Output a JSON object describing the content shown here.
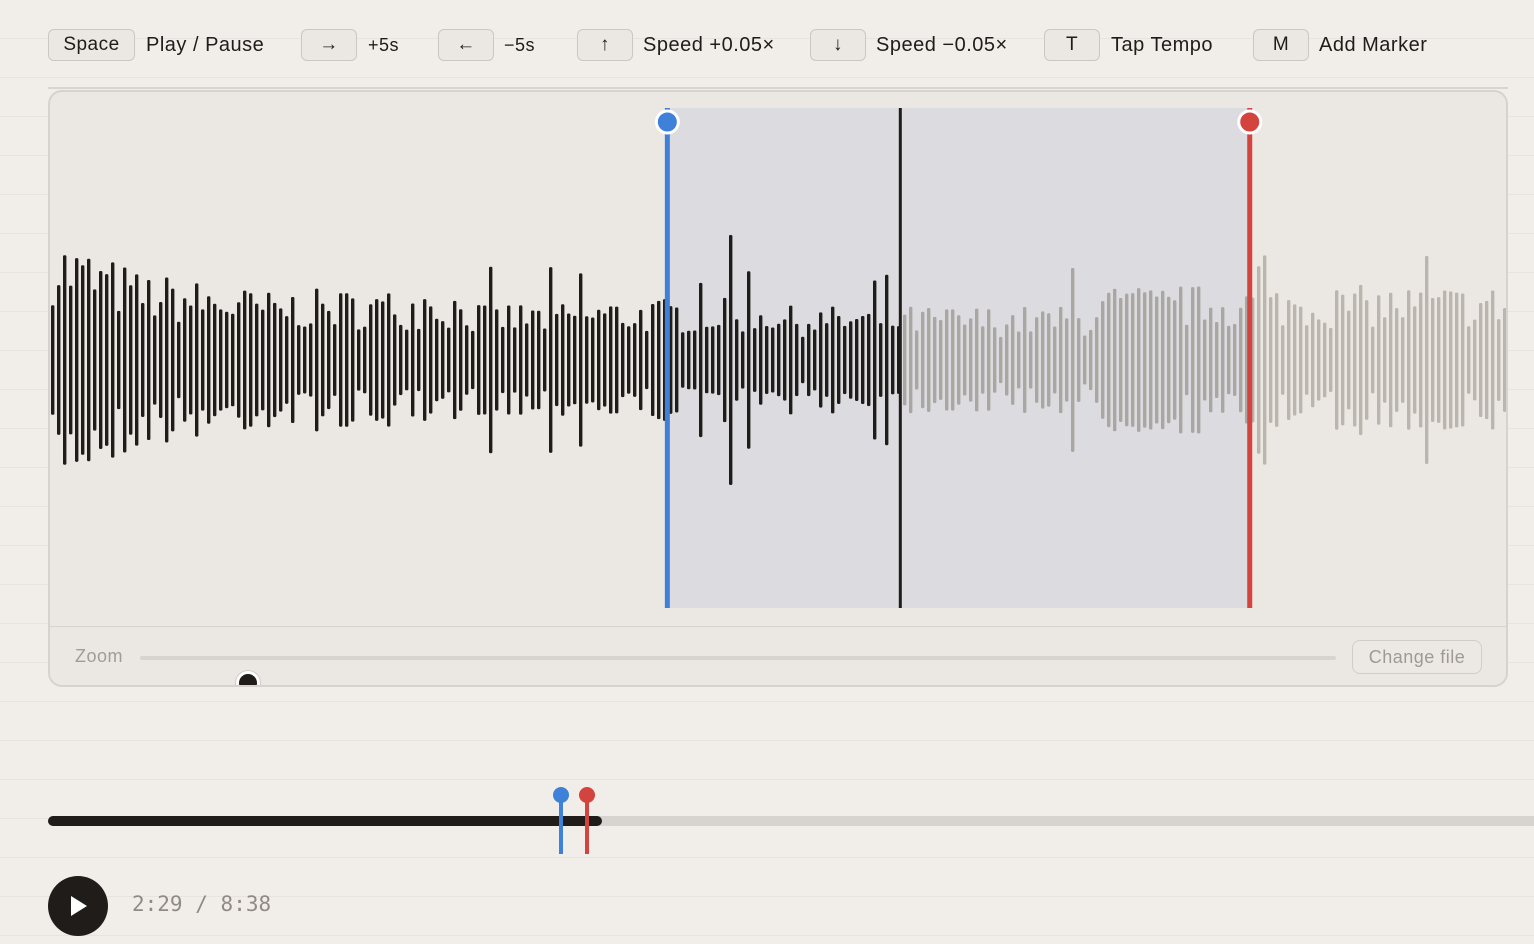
{
  "shortcuts": [
    {
      "key": "Space",
      "label": "Play / Pause"
    },
    {
      "key": "→",
      "label": "+5s"
    },
    {
      "key": "←",
      "label": "−5s"
    },
    {
      "key": "↑",
      "label": "Speed +0.05×"
    },
    {
      "key": "↓",
      "label": "Speed −0.05×"
    },
    {
      "key": "T",
      "label": "Tap Tempo"
    },
    {
      "key": "M",
      "label": "Add Marker"
    }
  ],
  "waveform": {
    "loop_start_seconds": 139,
    "playhead_seconds": 149,
    "loop_end_seconds": 164,
    "colors": {
      "played": "#1f1c19",
      "unplayed": "#aaa7a3",
      "outside_loop": "#bab5ae",
      "loop_region": "#dcdce0",
      "start_marker": "#3f80d8",
      "end_marker": "#d2443d",
      "playhead": "#1f1c19"
    }
  },
  "zoom": {
    "label": "Zoom",
    "level": 0.09
  },
  "change_file_label": "Change file",
  "timeline": {
    "progress": 0.2888,
    "start_marker": 0.2673,
    "end_marker": 0.2807
  },
  "playback": {
    "current": "2:29",
    "separator": "/",
    "total": "8:38",
    "is_playing": false
  }
}
